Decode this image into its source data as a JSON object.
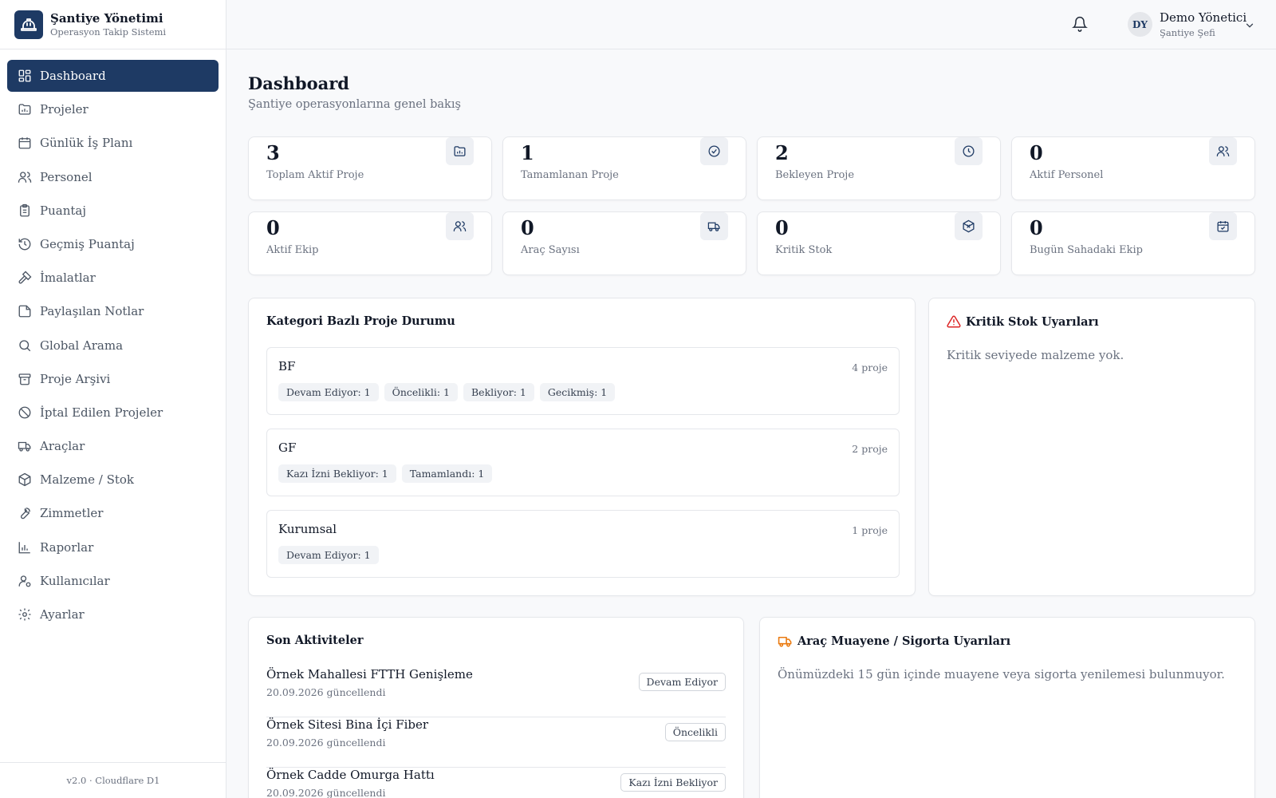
{
  "brand": {
    "title": "Şantiye Yönetimi",
    "subtitle": "Operasyon Takip Sistemi",
    "logo_icon": "hard-hat-icon"
  },
  "colors": {
    "primary": "#1e3a64",
    "warning_red": "#dc2626",
    "warning_orange": "#ea7a10"
  },
  "nav": [
    {
      "label": "Dashboard",
      "icon": "dashboard-icon",
      "active": true
    },
    {
      "label": "Projeler",
      "icon": "folder-chart-icon"
    },
    {
      "label": "Günlük İş Planı",
      "icon": "calendar-icon"
    },
    {
      "label": "Personel",
      "icon": "users-icon"
    },
    {
      "label": "Puantaj",
      "icon": "clipboard-icon"
    },
    {
      "label": "Geçmiş Puantaj",
      "icon": "history-icon"
    },
    {
      "label": "İmalatlar",
      "icon": "hammer-icon"
    },
    {
      "label": "Paylaşılan Notlar",
      "icon": "sticky-note-icon"
    },
    {
      "label": "Global Arama",
      "icon": "search-icon"
    },
    {
      "label": "Proje Arşivi",
      "icon": "archive-icon"
    },
    {
      "label": "İptal Edilen Projeler",
      "icon": "ban-icon"
    },
    {
      "label": "Araçlar",
      "icon": "truck-icon"
    },
    {
      "label": "Malzeme / Stok",
      "icon": "package-icon"
    },
    {
      "label": "Zimmetler",
      "icon": "wrench-icon"
    },
    {
      "label": "Raporlar",
      "icon": "bar-chart-icon"
    },
    {
      "label": "Kullanıcılar",
      "icon": "user-cog-icon"
    },
    {
      "label": "Ayarlar",
      "icon": "settings-icon"
    }
  ],
  "footer": {
    "version": "v2.0 · Cloudflare D1"
  },
  "user": {
    "initials": "DY",
    "name": "Demo Yönetici",
    "role": "Şantiye Şefi"
  },
  "page": {
    "title": "Dashboard",
    "subtitle": "Şantiye operasyonlarına genel bakış"
  },
  "stats": [
    {
      "value": "3",
      "label": "Toplam Aktif Proje",
      "icon": "folder-chart-icon"
    },
    {
      "value": "1",
      "label": "Tamamlanan Proje",
      "icon": "check-circle-icon"
    },
    {
      "value": "2",
      "label": "Bekleyen Proje",
      "icon": "clock-icon"
    },
    {
      "value": "0",
      "label": "Aktif Personel",
      "icon": "users-icon"
    },
    {
      "value": "0",
      "label": "Aktif Ekip",
      "icon": "users-icon"
    },
    {
      "value": "0",
      "label": "Araç Sayısı",
      "icon": "truck-icon"
    },
    {
      "value": "0",
      "label": "Kritik Stok",
      "icon": "package-x-icon"
    },
    {
      "value": "0",
      "label": "Bugün Sahadaki Ekip",
      "icon": "calendar-check-icon"
    }
  ],
  "category_panel": {
    "title": "Kategori Bazlı Proje Durumu",
    "categories": [
      {
        "name": "BF",
        "count": "4 proje",
        "chips": [
          "Devam Ediyor: 1",
          "Öncelikli: 1",
          "Bekliyor: 1",
          "Gecikmiş: 1"
        ]
      },
      {
        "name": "GF",
        "count": "2 proje",
        "chips": [
          "Kazı İzni Bekliyor: 1",
          "Tamamlandı: 1"
        ]
      },
      {
        "name": "Kurumsal",
        "count": "1 proje",
        "chips": [
          "Devam Ediyor: 1"
        ]
      }
    ]
  },
  "stock_panel": {
    "title": "Kritik Stok Uyarıları",
    "message": "Kritik seviyede malzeme yok.",
    "icon": "alert-triangle-icon"
  },
  "activity_panel": {
    "title": "Son Aktiviteler",
    "items": [
      {
        "name": "Örnek Mahallesi FTTH Genişleme",
        "date": "20.09.2026 güncellendi",
        "status": "Devam Ediyor"
      },
      {
        "name": "Örnek Sitesi Bina İçi Fiber",
        "date": "20.09.2026 güncellendi",
        "status": "Öncelikli"
      },
      {
        "name": "Örnek Cadde Omurga Hattı",
        "date": "20.09.2026 güncellendi",
        "status": "Kazı İzni Bekliyor"
      }
    ]
  },
  "vehicle_panel": {
    "title": "Araç Muayene / Sigorta Uyarıları",
    "message": "Önümüzdeki 15 gün içinde muayene veya sigorta yenilemesi bulunmuyor.",
    "icon": "truck-icon"
  }
}
